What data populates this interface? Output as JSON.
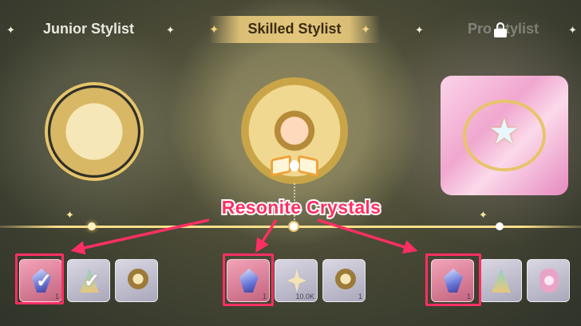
{
  "tabs": [
    {
      "label": "Junior Stylist",
      "state": "completed"
    },
    {
      "label": "Skilled Stylist",
      "state": "active"
    },
    {
      "label": "Pro Stylist",
      "state": "locked"
    }
  ],
  "callout": {
    "text": "Resonite Crystals",
    "color": "#ff2f63"
  },
  "reward_groups": [
    {
      "tier": "Junior Stylist",
      "items": [
        {
          "icon": "resonite-crystal-icon",
          "quantity": "1",
          "claimed": true
        },
        {
          "icon": "fan-ornament-icon",
          "quantity": "",
          "claimed": true
        },
        {
          "icon": "gold-charm-icon",
          "quantity": "",
          "claimed": false
        }
      ]
    },
    {
      "tier": "Skilled Stylist",
      "items": [
        {
          "icon": "resonite-crystal-icon",
          "quantity": "1",
          "claimed": false
        },
        {
          "icon": "star-bling-icon",
          "quantity": "10.0K",
          "claimed": false
        },
        {
          "icon": "gold-charm-icon",
          "quantity": "1",
          "claimed": false
        }
      ]
    },
    {
      "tier": "Pro Stylist",
      "items": [
        {
          "icon": "resonite-crystal-icon",
          "quantity": "1",
          "claimed": false
        },
        {
          "icon": "fan-ornament-icon",
          "quantity": "",
          "claimed": false
        },
        {
          "icon": "pink-flower-icon",
          "quantity": "",
          "claimed": false
        }
      ]
    }
  ],
  "colors": {
    "highlight": "#ff2f63",
    "gold": "#e3c67c"
  }
}
